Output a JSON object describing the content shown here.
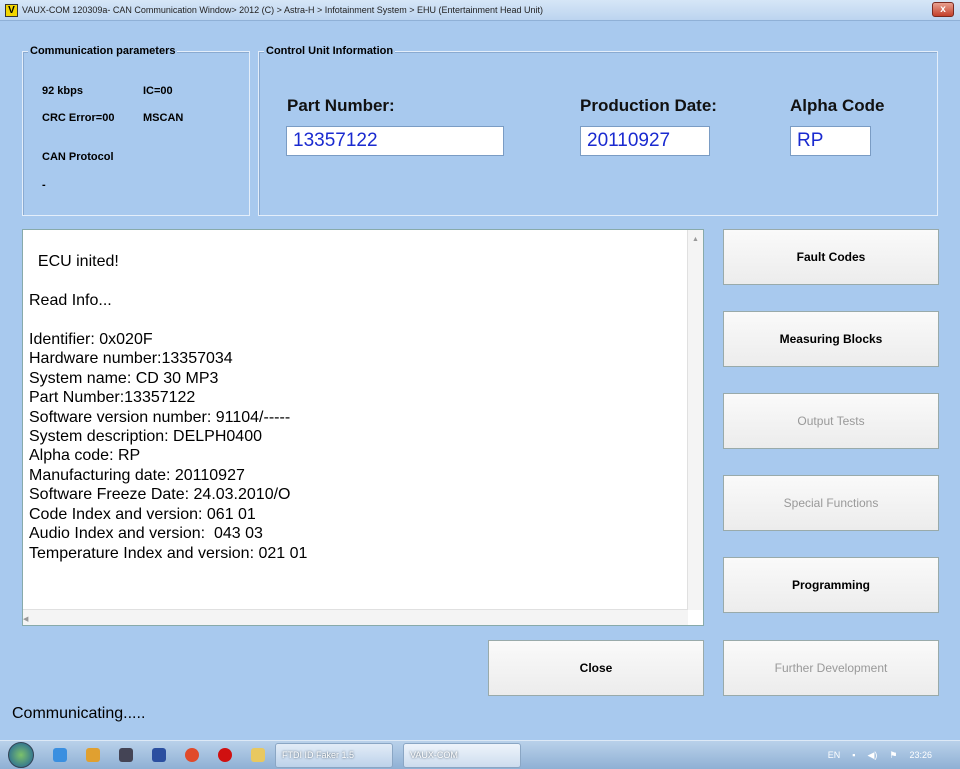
{
  "window": {
    "title": "VAUX-COM 120309a- CAN Communication Window> 2012 (C) > Astra-H > Infotainment System > EHU (Entertainment Head Unit)",
    "logo": "V",
    "close": "x"
  },
  "comm": {
    "label": "Communication parameters",
    "speed": "92 kbps",
    "ic": "IC=00",
    "crc": "CRC Error=00",
    "mscan": "MSCAN",
    "protocol_label": "CAN Protocol",
    "protocol_value": "-"
  },
  "cu": {
    "label": "Control Unit Information",
    "part_label": "Part Number:",
    "part_value": "13357122",
    "date_label": "Production Date:",
    "date_value": "20110927",
    "alpha_label": "Alpha Code",
    "alpha_value": "RP"
  },
  "log": "ECU inited!\n\nRead Info...\n\nIdentifier: 0x020F\nHardware number:13357034\nSystem name: CD 30 MP3\nPart Number:13357122\nSoftware version number: 91104/-----\nSystem description: DELPH0400\nAlpha code: RP\nManufacturing date: 20110927\nSoftware Freeze Date: 24.03.2010/O\nCode Index and version: 061 01\nAudio Index and version:  043 03\nTemperature Index and version: 021 01",
  "buttons": {
    "fault": "Fault Codes",
    "measuring": "Measuring Blocks",
    "output": "Output Tests",
    "special": "Special Functions",
    "programming": "Programming",
    "close": "Close",
    "further": "Further Development"
  },
  "status": "Communicating.....",
  "taskbar": {
    "task1": "FTDI ID Faker 1.5",
    "task2": "VAUX-COM",
    "lang": "EN",
    "time": "23:26"
  }
}
